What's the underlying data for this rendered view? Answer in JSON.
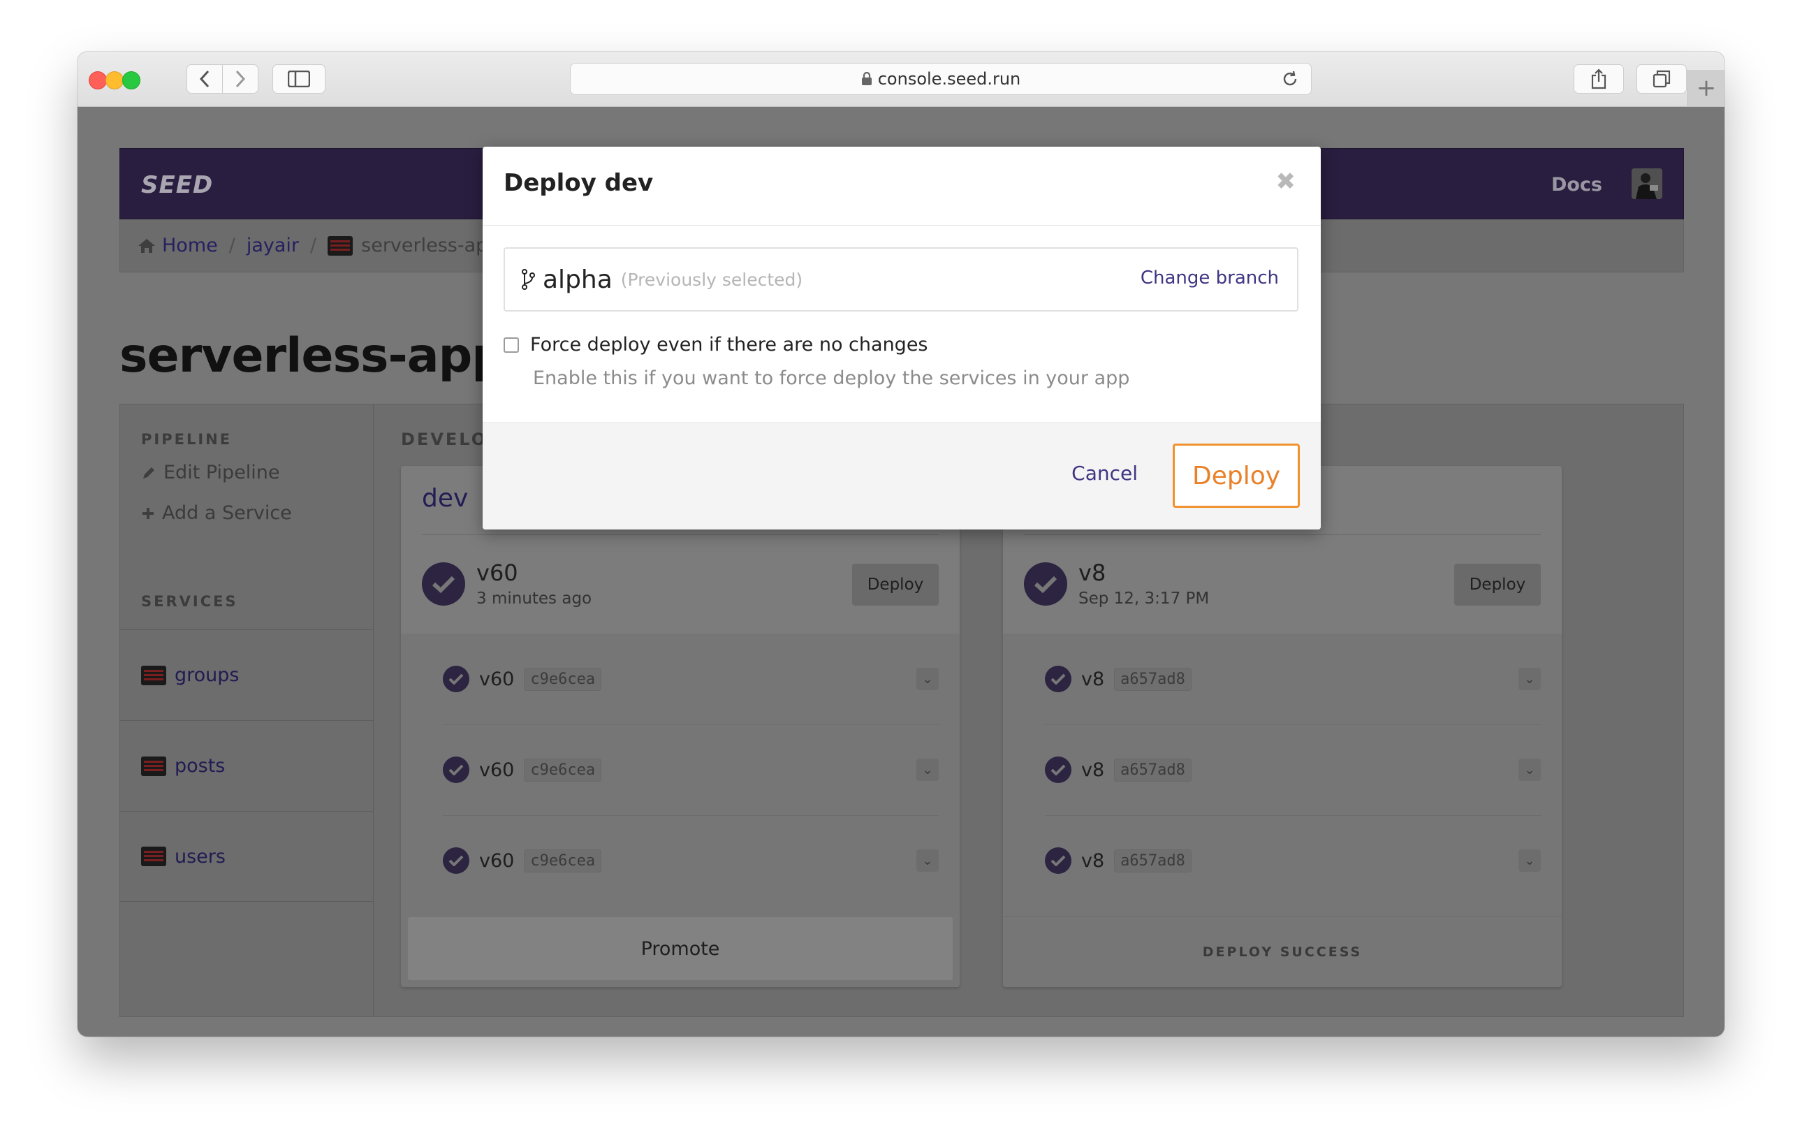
{
  "browser": {
    "url": "console.seed.run"
  },
  "navbar": {
    "logo": "SEED",
    "docs_label": "Docs"
  },
  "breadcrumb": {
    "home": "Home",
    "org": "jayair",
    "app": "serverless-ap"
  },
  "page": {
    "title": "serverless-app"
  },
  "sidebar": {
    "pipeline_header": "PIPELINE",
    "edit_pipeline": "Edit Pipeline",
    "add_service": "Add a Service",
    "services_header": "SERVICES",
    "services": [
      "groups",
      "posts",
      "users"
    ]
  },
  "pipeline": {
    "section_header": "DEVELO",
    "stages": [
      {
        "name": "dev",
        "version": "v60",
        "time": "3 minutes ago",
        "deploy_label": "Deploy",
        "rows": [
          {
            "version": "v60",
            "sha": "c9e6cea"
          },
          {
            "version": "v60",
            "sha": "c9e6cea"
          },
          {
            "version": "v60",
            "sha": "c9e6cea"
          }
        ],
        "footer_label": "Promote"
      },
      {
        "name": "",
        "version": "v8",
        "time": "Sep 12, 3:17 PM",
        "deploy_label": "Deploy",
        "rows": [
          {
            "version": "v8",
            "sha": "a657ad8"
          },
          {
            "version": "v8",
            "sha": "a657ad8"
          },
          {
            "version": "v8",
            "sha": "a657ad8"
          }
        ],
        "footer_label": "DEPLOY SUCCESS"
      }
    ]
  },
  "modal": {
    "title": "Deploy dev",
    "close_symbol": "✖",
    "branch": "alpha",
    "branch_note": "(Previously selected)",
    "change_branch": "Change branch",
    "force_label": "Force deploy even if there are no changes",
    "force_help": "Enable this if you want to force deploy the services in your app",
    "cancel_label": "Cancel",
    "deploy_label": "Deploy"
  },
  "colors": {
    "navbar": "#291e3f",
    "accent": "#3f3583",
    "deploy_orange": "#e8812a",
    "check": "#2c2440"
  }
}
